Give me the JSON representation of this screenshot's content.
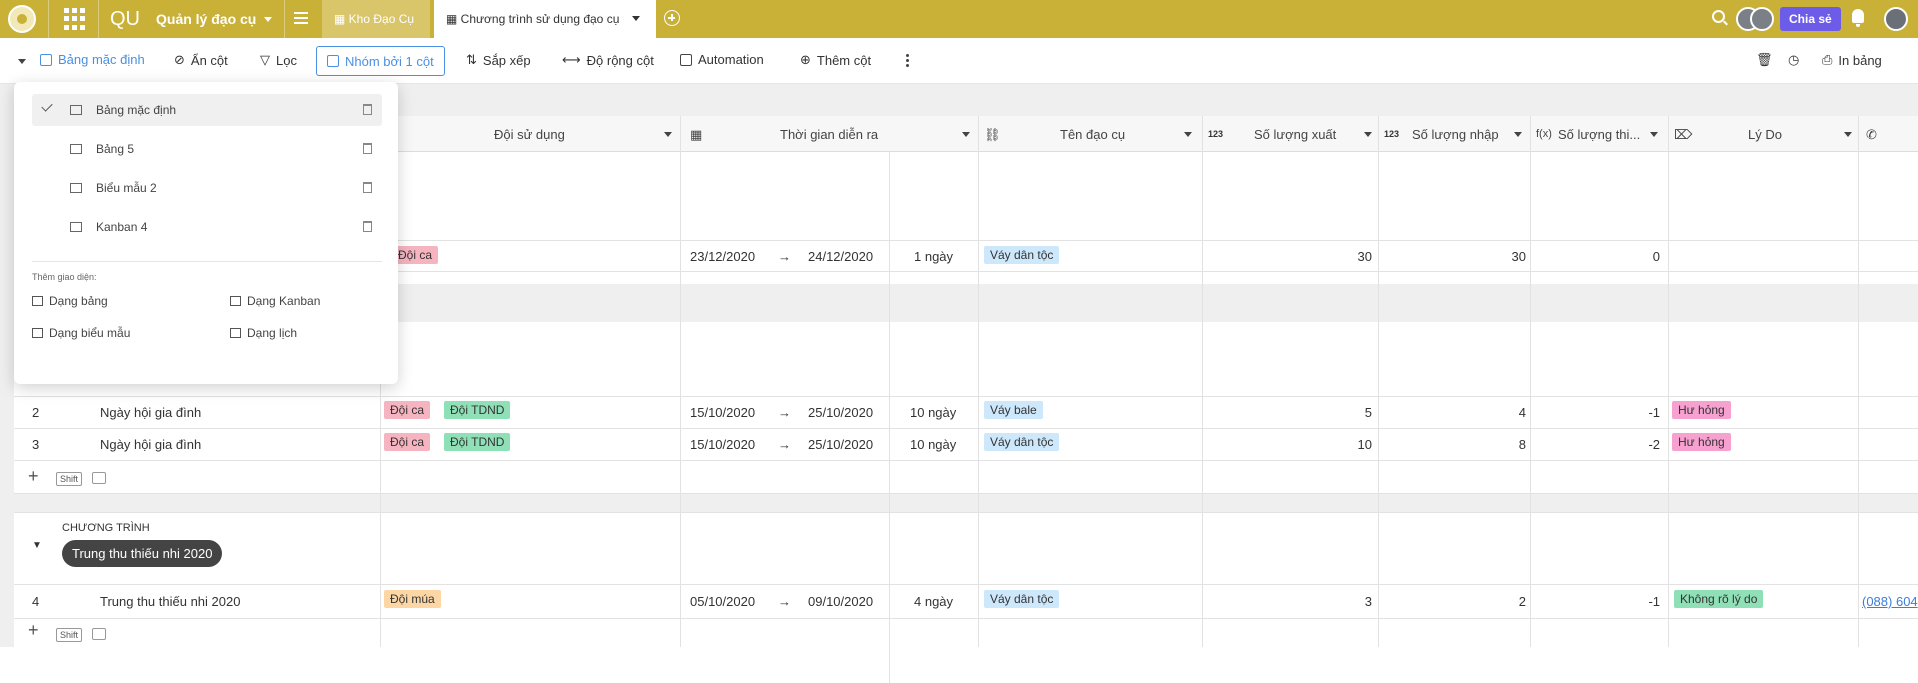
{
  "topbar": {
    "app_abbr": "QU",
    "app_name": "Quản lý đạo cụ",
    "tab_inactive": "Kho Đạo Cụ",
    "tab_active": "Chương trình sử dụng đạo cụ",
    "share": "Chia sẻ",
    "accent": "#c9b138"
  },
  "toolbar": {
    "view": "Bảng mặc định",
    "hide": "Ẩn cột",
    "filter": "Lọc",
    "group": "Nhóm bởi 1 cột",
    "sort": "Sắp xếp",
    "width": "Độ rộng cột",
    "automation": "Automation",
    "add_column": "Thêm cột",
    "print": "In bảng"
  },
  "dropdown": {
    "views": [
      {
        "label": "Bảng mặc định",
        "icon": "grid-icon",
        "active": true
      },
      {
        "label": "Bảng 5",
        "icon": "grid-icon",
        "active": false
      },
      {
        "label": "Biểu mẫu 2",
        "icon": "form-icon",
        "active": false
      },
      {
        "label": "Kanban 4",
        "icon": "kanban-icon",
        "active": false
      }
    ],
    "add_title": "Thêm giao diện:",
    "add_options": [
      "Dạng bảng",
      "Dạng Kanban",
      "Dạng biểu mẫu",
      "Dạng lịch"
    ]
  },
  "columns": {
    "team": "Đội sử dụng",
    "time": "Thời gian diễn ra",
    "prop": "Tên đạo cụ",
    "out_tag": "123",
    "out": "Số lượng xuất",
    "in_tag": "123",
    "in": "Số lượng nhập",
    "diff_tag": "f(x)",
    "diff": "Số lượng thi...",
    "reason": "Lý Do"
  },
  "rows": [
    {
      "id": "",
      "name": "",
      "teams": [
        "Đội ca"
      ],
      "start": "23/12/2020",
      "end": "24/12/2020",
      "duration": "1 ngày",
      "prop": "Váy dân tộc",
      "out": "30",
      "in": "30",
      "diff": "0",
      "reason": ""
    },
    {
      "id": "2",
      "name": "Ngày hội gia đình",
      "teams": [
        "Đội ca",
        "Đội TDND"
      ],
      "start": "15/10/2020",
      "end": "25/10/2020",
      "duration": "10 ngày",
      "prop": "Váy bale",
      "out": "5",
      "in": "4",
      "diff": "-1",
      "reason": "Hư hỏng"
    },
    {
      "id": "3",
      "name": "Ngày hội gia đình",
      "teams": [
        "Đội ca",
        "Đội TDND"
      ],
      "start": "15/10/2020",
      "end": "25/10/2020",
      "duration": "10 ngày",
      "prop": "Váy dân tộc",
      "out": "10",
      "in": "8",
      "diff": "-2",
      "reason": "Hư hỏng"
    },
    {
      "id": "4",
      "name": "Trung thu thiếu nhi 2020",
      "teams": [
        "Đội múa"
      ],
      "start": "05/10/2020",
      "end": "09/10/2020",
      "duration": "4 ngày",
      "prop": "Váy dân tộc",
      "out": "3",
      "in": "2",
      "diff": "-1",
      "reason": "Không rõ lý do",
      "phone": "(088) 604"
    }
  ],
  "group": {
    "label": "CHƯƠNG TRÌNH",
    "value": "Trung thu thiếu nhi 2020"
  },
  "kbd": {
    "shift": "Shift"
  }
}
